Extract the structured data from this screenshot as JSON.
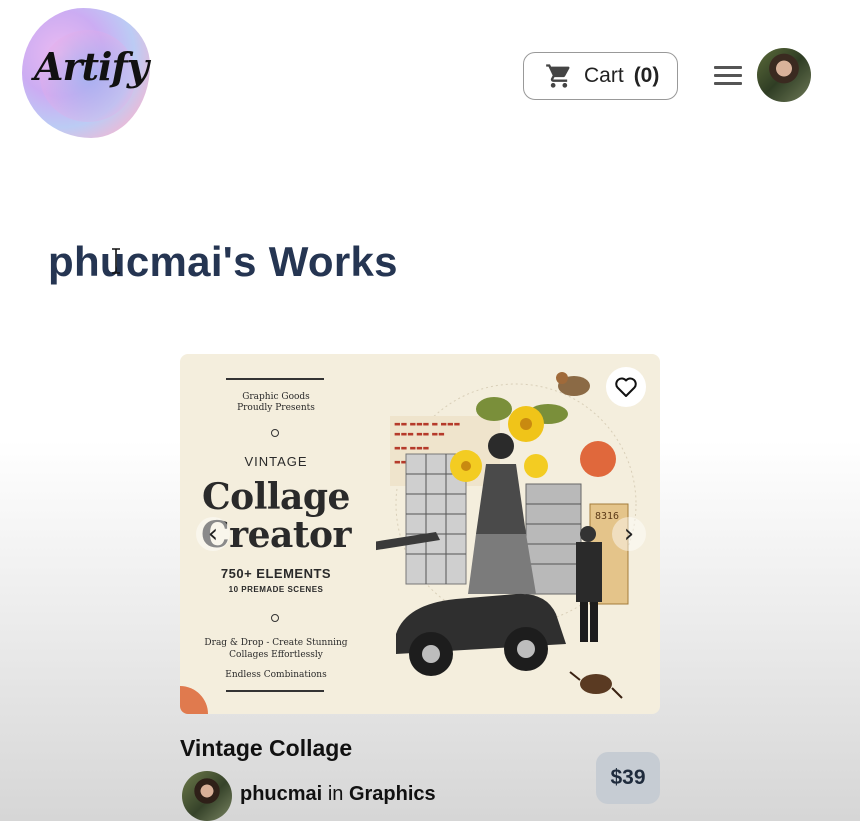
{
  "header": {
    "logo_text": "Artify",
    "cart": {
      "label": "Cart",
      "count": "(0)"
    }
  },
  "page": {
    "title": "phucmai's Works"
  },
  "card": {
    "image_text": {
      "brand_line1": "Graphic Goods",
      "brand_line2": "Proudly Presents",
      "kicker": "VINTAGE",
      "title_line1": "Collage",
      "title_line2": "Creator",
      "elements": "750+ ELEMENTS",
      "scenes": "10 PREMADE SCENES",
      "tag_line1": "Drag & Drop - Create Stunning",
      "tag_line2": "Collages Effortlessly",
      "tag_line3": "Endless Combinations"
    },
    "title": "Vintage Collage",
    "seller": "phucmai",
    "in_label": "in",
    "category": "Graphics",
    "price": "$39"
  },
  "icons": {
    "cart": "cart-icon",
    "menu": "hamburger-menu-icon",
    "favorite": "heart-outline-icon",
    "prev": "chevron-left-icon",
    "next": "chevron-right-icon"
  },
  "colors": {
    "title": "#253552",
    "price_badge": "#c6ccd3",
    "card_bg": "#f4eedd"
  }
}
